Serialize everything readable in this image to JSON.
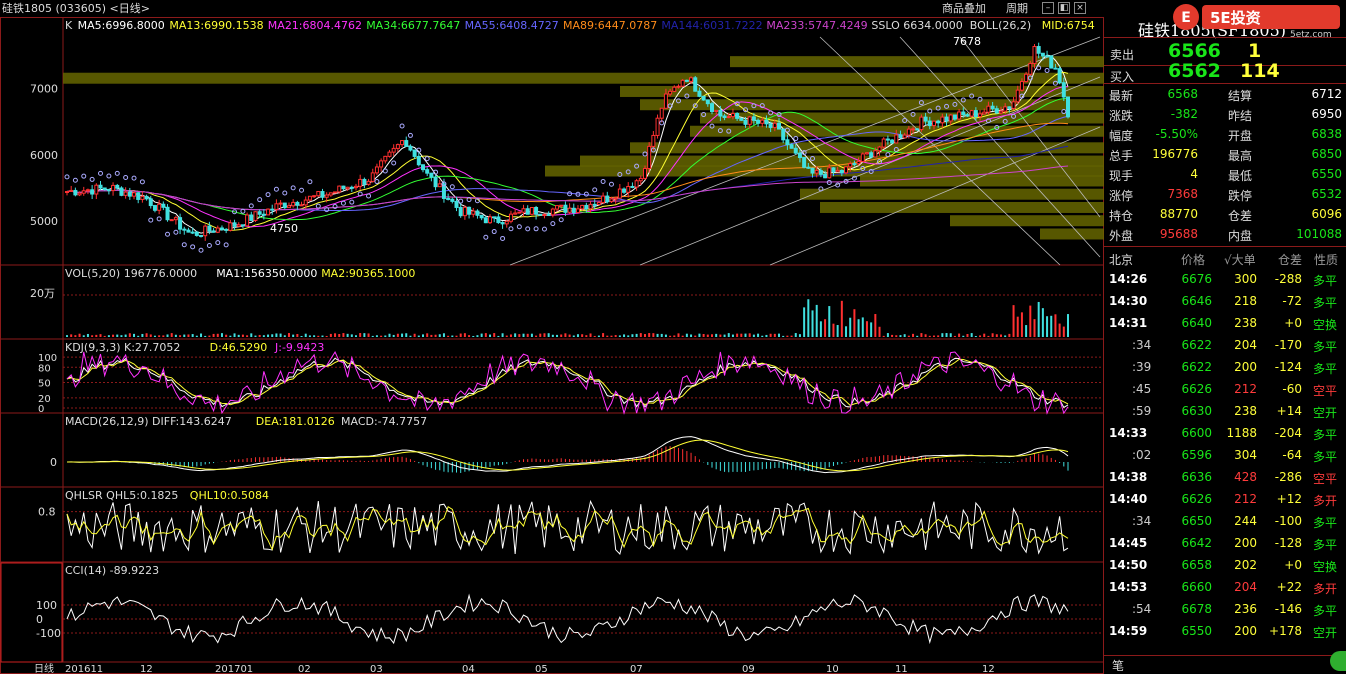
{
  "window": {
    "title": "硅铁1805 (033605) <日线>",
    "menu": [
      "商品叠加",
      "周期"
    ]
  },
  "main_legend": [
    {
      "text": "K",
      "color": "#dddddd"
    },
    {
      "text": "MA5:6996.8000",
      "color": "#ffffff"
    },
    {
      "text": "MA13:6990.1538",
      "color": "#ffff33"
    },
    {
      "text": "MA21:6804.4762",
      "color": "#ff33ff"
    },
    {
      "text": "MA34:6677.7647",
      "color": "#33ff33"
    },
    {
      "text": "MA55:6408.4727",
      "color": "#6666ff"
    },
    {
      "text": "MA89:6447.0787",
      "color": "#ff8c1a"
    },
    {
      "text": "MA144:6031.7222",
      "color": "#2222aa"
    },
    {
      "text": "MA233:5747.4249",
      "color": "#cc44cc"
    },
    {
      "text": "SSLO 6634.0000",
      "color": "#dddddd"
    },
    {
      "text": "BOLL(26,2)",
      "color": "#dddddd"
    },
    {
      "text": "MID:6754",
      "color": "#ffff33"
    }
  ],
  "price_axis": [
    "7000",
    "6000",
    "5000"
  ],
  "annotations": {
    "high": "7678",
    "low": "4750"
  },
  "vol_legend": [
    {
      "text": "VOL(5,20)  196776.0000",
      "color": "#dddddd"
    },
    {
      "text": "MA1:156350.0000",
      "color": "#ffffff"
    },
    {
      "text": "MA2:90365.1000",
      "color": "#ffff33"
    }
  ],
  "vol_axis": [
    "20万"
  ],
  "kdj_legend": [
    {
      "text": "KDJ(9,3,3)  K:27.7052",
      "color": "#dddddd"
    },
    {
      "text": "D:46.5290",
      "color": "#ffff33"
    },
    {
      "text": "J:-9.9423",
      "color": "#ff33ff"
    }
  ],
  "kdj_axis": [
    "100",
    "80",
    "50",
    "20",
    "0"
  ],
  "macd_legend": [
    {
      "text": "MACD(26,12,9)  DIFF:143.6247",
      "color": "#dddddd"
    },
    {
      "text": "DEA:181.0126",
      "color": "#ffff33"
    },
    {
      "text": "MACD:-74.7757",
      "color": "#dddddd"
    }
  ],
  "macd_axis": [
    "0"
  ],
  "qhlsr_legend": [
    {
      "text": "QHLSR  QHL5:0.1825",
      "color": "#dddddd"
    },
    {
      "text": "QHL10:0.5084",
      "color": "#ffff33"
    }
  ],
  "qhlsr_axis": [
    "0.8"
  ],
  "cci_legend": [
    {
      "text": "CCI(14)  -89.9223",
      "color": "#dddddd"
    }
  ],
  "cci_axis": [
    "100",
    "0",
    "-100"
  ],
  "x_axis": [
    "日线",
    "201611",
    "12",
    "201701",
    "02",
    "03",
    "04",
    "05",
    "07",
    "09",
    "10",
    "11",
    "12"
  ],
  "quote": {
    "name": "硅铁1805(SF1805)",
    "logo": "5E投资",
    "logo_sub": "5etz.com",
    "ask_label": "卖出",
    "ask_price": "6566",
    "ask_vol": "1",
    "bid_label": "买入",
    "bid_price": "6562",
    "bid_vol": "114",
    "stats": [
      {
        "l1": "最新",
        "v1": "6568",
        "c1": "green",
        "l2": "结算",
        "v2": "6712",
        "c2": "white"
      },
      {
        "l1": "涨跌",
        "v1": "-382",
        "c1": "green",
        "l2": "昨结",
        "v2": "6950",
        "c2": "white"
      },
      {
        "l1": "幅度",
        "v1": "-5.50%",
        "c1": "green",
        "l2": "开盘",
        "v2": "6838",
        "c2": "green"
      },
      {
        "l1": "总手",
        "v1": "196776",
        "c1": "yellow",
        "l2": "最高",
        "v2": "6850",
        "c2": "green"
      },
      {
        "l1": "现手",
        "v1": "4",
        "c1": "yellow",
        "l2": "最低",
        "v2": "6550",
        "c2": "green"
      },
      {
        "l1": "涨停",
        "v1": "7368",
        "c1": "red",
        "l2": "跌停",
        "v2": "6532",
        "c2": "green"
      },
      {
        "l1": "持仓",
        "v1": "88770",
        "c1": "yellow",
        "l2": "仓差",
        "v2": "6096",
        "c2": "yellow"
      },
      {
        "l1": "外盘",
        "v1": "95688",
        "c1": "red",
        "l2": "内盘",
        "v2": "101088",
        "c2": "green"
      }
    ],
    "ticks_header": [
      "北京",
      "价格",
      "√大单",
      "仓差",
      "性质"
    ],
    "ticks": [
      {
        "t": "14:26",
        "p": "6676",
        "v": "300",
        "d": "-288",
        "k": "多平",
        "kc": "green",
        "dc": "yellow",
        "vc": "yellow"
      },
      {
        "t": "14:30",
        "p": "6646",
        "v": "218",
        "d": "-72",
        "k": "多平",
        "kc": "green",
        "dc": "yellow",
        "vc": "yellow"
      },
      {
        "t": "14:31",
        "p": "6640",
        "v": "238",
        "d": "+0",
        "k": "空换",
        "kc": "green",
        "dc": "yellow",
        "vc": "yellow"
      },
      {
        "t": ":34",
        "p": "6622",
        "v": "204",
        "d": "-170",
        "k": "多平",
        "kc": "green",
        "dc": "yellow",
        "vc": "yellow"
      },
      {
        "t": ":39",
        "p": "6622",
        "v": "200",
        "d": "-124",
        "k": "多平",
        "kc": "green",
        "dc": "yellow",
        "vc": "yellow"
      },
      {
        "t": ":45",
        "p": "6626",
        "v": "212",
        "d": "-60",
        "k": "空平",
        "kc": "red",
        "dc": "yellow",
        "vc": "red"
      },
      {
        "t": ":59",
        "p": "6630",
        "v": "238",
        "d": "+14",
        "k": "空开",
        "kc": "green",
        "dc": "yellow",
        "vc": "yellow"
      },
      {
        "t": "14:33",
        "p": "6600",
        "v": "1188",
        "d": "-204",
        "k": "多平",
        "kc": "green",
        "dc": "yellow",
        "vc": "yellow"
      },
      {
        "t": ":02",
        "p": "6596",
        "v": "304",
        "d": "-64",
        "k": "多平",
        "kc": "green",
        "dc": "yellow",
        "vc": "yellow"
      },
      {
        "t": "14:38",
        "p": "6636",
        "v": "428",
        "d": "-286",
        "k": "空平",
        "kc": "red",
        "dc": "yellow",
        "vc": "red"
      },
      {
        "t": "14:40",
        "p": "6626",
        "v": "212",
        "d": "+12",
        "k": "多开",
        "kc": "red",
        "dc": "yellow",
        "vc": "red"
      },
      {
        "t": ":34",
        "p": "6650",
        "v": "244",
        "d": "-100",
        "k": "多平",
        "kc": "green",
        "dc": "yellow",
        "vc": "yellow"
      },
      {
        "t": "14:45",
        "p": "6642",
        "v": "200",
        "d": "-128",
        "k": "多平",
        "kc": "green",
        "dc": "yellow",
        "vc": "yellow"
      },
      {
        "t": "14:50",
        "p": "6658",
        "v": "202",
        "d": "+0",
        "k": "空换",
        "kc": "green",
        "dc": "yellow",
        "vc": "yellow"
      },
      {
        "t": "14:53",
        "p": "6660",
        "v": "204",
        "d": "+22",
        "k": "多开",
        "kc": "red",
        "dc": "yellow",
        "vc": "red"
      },
      {
        "t": ":54",
        "p": "6678",
        "v": "236",
        "d": "-146",
        "k": "多平",
        "kc": "green",
        "dc": "yellow",
        "vc": "yellow"
      },
      {
        "t": "14:59",
        "p": "6550",
        "v": "200",
        "d": "+178",
        "k": "空开",
        "kc": "green",
        "dc": "yellow",
        "vc": "yellow"
      }
    ],
    "footer_label": "笔"
  }
}
